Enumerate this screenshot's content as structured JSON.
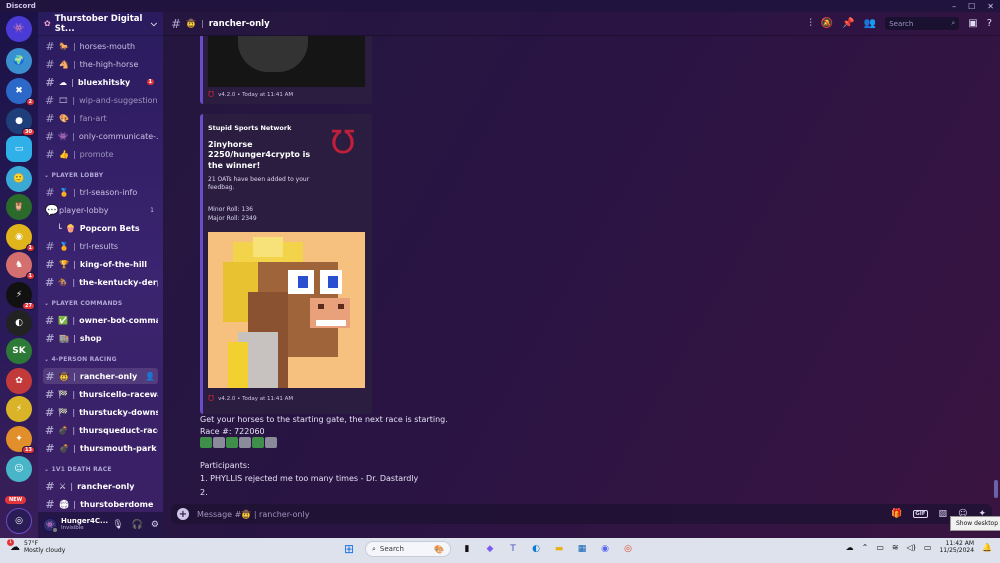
{
  "app": {
    "title": "Discord"
  },
  "servers": {
    "badges": [
      "2",
      "30",
      "1",
      "1",
      "27",
      "13"
    ],
    "new_label": "NEW"
  },
  "guild": {
    "name": "Thurstober Digital St..."
  },
  "channels": {
    "top": [
      {
        "emoji": "🐎",
        "name": "horses-mouth"
      },
      {
        "emoji": "🐴",
        "name": "the-high-horse"
      },
      {
        "emoji": "☁",
        "name": "bluexhitsky",
        "badge": "1"
      },
      {
        "emoji": "🎞",
        "name": "wip-and-suggestions"
      },
      {
        "emoji": "🎨",
        "name": "fan-art"
      },
      {
        "emoji": "👾",
        "name": "only-communicate-..."
      },
      {
        "emoji": "👍",
        "name": "promote"
      }
    ],
    "cat_player_lobby": "PLAYER LOBBY",
    "player_lobby": [
      {
        "emoji": "🏅",
        "name": "trl-season-info"
      },
      {
        "emoji": "",
        "name": "player-lobby",
        "count": "1"
      },
      {
        "emoji": "🍿",
        "name": "Popcorn Bets"
      },
      {
        "emoji": "🏅",
        "name": "trl-results"
      },
      {
        "emoji": "🏆",
        "name": "king-of-the-hill"
      },
      {
        "emoji": "🏇",
        "name": "the-kentucky-derpy"
      }
    ],
    "cat_player_commands": "PLAYER COMMANDS",
    "player_commands": [
      {
        "emoji": "✅",
        "name": "owner-bot-comma..."
      },
      {
        "emoji": "🏬",
        "name": "shop"
      }
    ],
    "cat_4_person": "4-PERSON RACING",
    "four_person": [
      {
        "emoji": "🤠",
        "name": "rancher-only"
      },
      {
        "emoji": "🏁",
        "name": "thursicello-raceway"
      },
      {
        "emoji": "🏁",
        "name": "thurstucky-downs"
      },
      {
        "emoji": "💣",
        "name": "thursqueduct-race-..."
      },
      {
        "emoji": "💣",
        "name": "thursmouth-park"
      }
    ],
    "cat_1v1": "1V1 DEATH RACE",
    "one_v_one": [
      {
        "emoji": "⚔",
        "name": "rancher-only"
      },
      {
        "emoji": "🏟",
        "name": "thurstoberdome"
      }
    ]
  },
  "user": {
    "name": "Hunger4C...",
    "status": "Invisible"
  },
  "topbar": {
    "emoji": "🤠",
    "channel": "rancher-only",
    "search_placeholder": "Search"
  },
  "embed1": {
    "version": "v4.2.0 • Today at 11:41 AM"
  },
  "embed2": {
    "author": "Stupid Sports Network",
    "winner": "2inyhorse 2250/hunger4crypto is the winner!",
    "desc": "21 OATs have been added to your feedbag.",
    "minor": "Minor Roll: 136",
    "major": "Major Roll: 2349",
    "version": "v4.2.0 • Today at 11:41 AM"
  },
  "message": {
    "line1": "Get your horses to the starting gate, the next race is starting.",
    "race": "Race #: 722060",
    "participants_label": "Participants:",
    "p1": "1. PHYLLIS rejected me too many times - Dr. Dastardly",
    "p2": "2."
  },
  "input": {
    "placeholder": "Message #🤠 | rancher-only",
    "gif": "GIF"
  },
  "tooltip": "Show desktop",
  "taskbar": {
    "temp": "57°F",
    "weather": "Mostly cloudy",
    "weather_badge": "1",
    "search": "Search",
    "time": "11:42 AM",
    "date": "11/25/2024"
  },
  "colors": {
    "accent": "#6a4bc9",
    "badge": "#e0353b",
    "background": "#24163f"
  }
}
